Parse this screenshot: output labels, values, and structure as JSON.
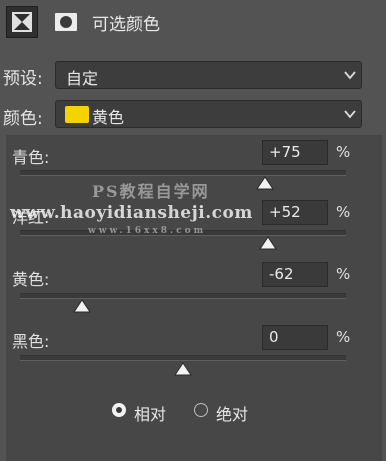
{
  "panel": {
    "title": "可选颜色",
    "icons": [
      "selective-color-adjustment-icon",
      "layer-mask-icon"
    ]
  },
  "preset": {
    "label": "预设:",
    "value": "自定"
  },
  "colors": {
    "label": "颜色:",
    "value": "黄色",
    "swatch": "#f5d300"
  },
  "sliders": [
    {
      "label": "青色:",
      "value": "+75",
      "unit": "%",
      "position": 0.75
    },
    {
      "label": "洋红:",
      "value": "+52",
      "unit": "%",
      "position": 0.76
    },
    {
      "label": "黄色:",
      "value": "-62",
      "unit": "%",
      "position": 0.19
    },
    {
      "label": "黑色:",
      "value": "0",
      "unit": "%",
      "position": 0.5
    }
  ],
  "method": {
    "options": [
      {
        "label": "相对",
        "selected": true
      },
      {
        "label": "绝对",
        "selected": false
      }
    ]
  },
  "watermark": {
    "line1": "PS教程自学网",
    "line2": "www.haoyidiansheji.com",
    "line3": "www.16xx8.com"
  },
  "accent": "#f5d300"
}
